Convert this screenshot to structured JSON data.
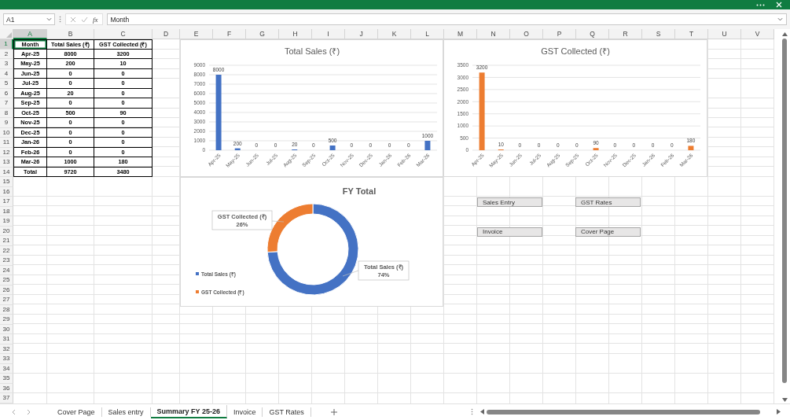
{
  "formula_bar": {
    "name_box": "A1",
    "function_label": "fx",
    "value": "Month"
  },
  "column_headers": [
    {
      "label": "A",
      "selected": true
    },
    {
      "label": "B",
      "selected": false
    },
    {
      "label": "C",
      "selected": false
    },
    {
      "label": "D",
      "selected": false
    },
    {
      "label": "E",
      "selected": false
    },
    {
      "label": "F",
      "selected": false
    },
    {
      "label": "G",
      "selected": false
    },
    {
      "label": "H",
      "selected": false
    },
    {
      "label": "I",
      "selected": false
    },
    {
      "label": "J",
      "selected": false
    },
    {
      "label": "K",
      "selected": false
    },
    {
      "label": "L",
      "selected": false
    },
    {
      "label": "M",
      "selected": false
    },
    {
      "label": "N",
      "selected": false
    },
    {
      "label": "O",
      "selected": false
    },
    {
      "label": "P",
      "selected": false
    },
    {
      "label": "Q",
      "selected": false
    },
    {
      "label": "R",
      "selected": false
    },
    {
      "label": "S",
      "selected": false
    },
    {
      "label": "T",
      "selected": false
    },
    {
      "label": "U",
      "selected": false
    },
    {
      "label": "V",
      "selected": false
    }
  ],
  "row_headers": [
    {
      "label": "1",
      "selected": true
    },
    {
      "label": "2",
      "selected": false
    },
    {
      "label": "3",
      "selected": false
    },
    {
      "label": "4",
      "selected": false
    },
    {
      "label": "5",
      "selected": false
    },
    {
      "label": "6",
      "selected": false
    },
    {
      "label": "7",
      "selected": false
    },
    {
      "label": "8",
      "selected": false
    },
    {
      "label": "9",
      "selected": false
    },
    {
      "label": "10",
      "selected": false
    },
    {
      "label": "11",
      "selected": false
    },
    {
      "label": "12",
      "selected": false
    },
    {
      "label": "13",
      "selected": false
    },
    {
      "label": "14",
      "selected": false
    },
    {
      "label": "15",
      "selected": false
    },
    {
      "label": "16",
      "selected": false
    },
    {
      "label": "17",
      "selected": false
    },
    {
      "label": "18",
      "selected": false
    },
    {
      "label": "19",
      "selected": false
    },
    {
      "label": "20",
      "selected": false
    },
    {
      "label": "21",
      "selected": false
    },
    {
      "label": "22",
      "selected": false
    },
    {
      "label": "23",
      "selected": false
    },
    {
      "label": "24",
      "selected": false
    },
    {
      "label": "25",
      "selected": false
    },
    {
      "label": "26",
      "selected": false
    },
    {
      "label": "27",
      "selected": false
    },
    {
      "label": "28",
      "selected": false
    },
    {
      "label": "29",
      "selected": false
    },
    {
      "label": "30",
      "selected": false
    },
    {
      "label": "31",
      "selected": false
    },
    {
      "label": "32",
      "selected": false
    },
    {
      "label": "33",
      "selected": false
    },
    {
      "label": "34",
      "selected": false
    },
    {
      "label": "35",
      "selected": false
    },
    {
      "label": "36",
      "selected": false
    },
    {
      "label": "37",
      "selected": false
    }
  ],
  "table": {
    "rows": [
      [
        {
          "text": "Month",
          "selected": true
        },
        {
          "text": "Total Sales (₹)",
          "selected": false
        },
        {
          "text": "GST Collected (₹)",
          "selected": false
        }
      ],
      [
        {
          "text": "Apr-25",
          "selected": false
        },
        {
          "text": "8000",
          "selected": false
        },
        {
          "text": "3200",
          "selected": false
        }
      ],
      [
        {
          "text": "May-25",
          "selected": false
        },
        {
          "text": "200",
          "selected": false
        },
        {
          "text": "10",
          "selected": false
        }
      ],
      [
        {
          "text": "Jun-25",
          "selected": false
        },
        {
          "text": "0",
          "selected": false
        },
        {
          "text": "0",
          "selected": false
        }
      ],
      [
        {
          "text": "Jul-25",
          "selected": false
        },
        {
          "text": "0",
          "selected": false
        },
        {
          "text": "0",
          "selected": false
        }
      ],
      [
        {
          "text": "Aug-25",
          "selected": false
        },
        {
          "text": "20",
          "selected": false
        },
        {
          "text": "0",
          "selected": false
        }
      ],
      [
        {
          "text": "Sep-25",
          "selected": false
        },
        {
          "text": "0",
          "selected": false
        },
        {
          "text": "0",
          "selected": false
        }
      ],
      [
        {
          "text": "Oct-25",
          "selected": false
        },
        {
          "text": "500",
          "selected": false
        },
        {
          "text": "90",
          "selected": false
        }
      ],
      [
        {
          "text": "Nov-25",
          "selected": false
        },
        {
          "text": "0",
          "selected": false
        },
        {
          "text": "0",
          "selected": false
        }
      ],
      [
        {
          "text": "Dec-25",
          "selected": false
        },
        {
          "text": "0",
          "selected": false
        },
        {
          "text": "0",
          "selected": false
        }
      ],
      [
        {
          "text": "Jan-26",
          "selected": false
        },
        {
          "text": "0",
          "selected": false
        },
        {
          "text": "0",
          "selected": false
        }
      ],
      [
        {
          "text": "Feb-26",
          "selected": false
        },
        {
          "text": "0",
          "selected": false
        },
        {
          "text": "0",
          "selected": false
        }
      ],
      [
        {
          "text": "Mar-26",
          "selected": false
        },
        {
          "text": "1000",
          "selected": false
        },
        {
          "text": "180",
          "selected": false
        }
      ],
      [
        {
          "text": "Total",
          "selected": false
        },
        {
          "text": "9720",
          "selected": false
        },
        {
          "text": "3480",
          "selected": false
        }
      ]
    ]
  },
  "charts": [
    {
      "chart_data": {
        "type": "bar",
        "title": "Total Sales (₹)",
        "categories": [
          "Apr-25",
          "May-25",
          "Jun-25",
          "Jul-25",
          "Aug-25",
          "Sep-25",
          "Oct-25",
          "Nov-25",
          "Dec-25",
          "Jan-26",
          "Feb-26",
          "Mar-26"
        ],
        "series": [
          {
            "color": "#4472c4",
            "values": [
              8000,
              200,
              0,
              0,
              20,
              0,
              500,
              0,
              0,
              0,
              0,
              1000
            ]
          }
        ],
        "grid": true,
        "ylim": [
          0,
          9000
        ],
        "yticks": [
          0,
          1000,
          2000,
          3000,
          4000,
          5000,
          6000,
          7000,
          8000,
          9000
        ],
        "data_labels": true
      }
    },
    {
      "chart_data": {
        "type": "bar",
        "title": "GST Collected (₹)",
        "categories": [
          "Apr-25",
          "May-25",
          "Jun-25",
          "Jul-25",
          "Aug-25",
          "Sep-25",
          "Oct-25",
          "Nov-25",
          "Dec-25",
          "Jan-26",
          "Feb-26",
          "Mar-26"
        ],
        "series": [
          {
            "color": "#ed7d31",
            "values": [
              3200,
              10,
              0,
              0,
              0,
              0,
              90,
              0,
              0,
              0,
              0,
              180
            ]
          }
        ],
        "grid": true,
        "ylim": [
          0,
          3500
        ],
        "yticks": [
          0,
          500,
          1000,
          1500,
          2000,
          2500,
          3000,
          3500
        ],
        "data_labels": true
      }
    }
  ],
  "donut": {
    "chart_data": {
      "type": "donut",
      "title": "FY Total",
      "categories": [
        "Total Sales (₹)",
        "GST Collected (₹)"
      ],
      "values": [
        74,
        26
      ],
      "value_labels": [
        "74%",
        "26%"
      ]
    },
    "legend": [
      {
        "label": "Total Sales (₹)",
        "color": "#4472c4"
      },
      {
        "label": "GST Collected (₹)",
        "color": "#ed7d31"
      }
    ]
  },
  "shape_buttons": [
    {
      "label": "Sales Entry"
    },
    {
      "label": "GST Rates"
    },
    {
      "label": "Invoice"
    },
    {
      "label": "Cover Page"
    }
  ],
  "sheet_tabs": [
    {
      "label": "Cover Page",
      "selected": false
    },
    {
      "label": "Sales entry",
      "selected": false
    },
    {
      "label": "Summary FY 25-26",
      "selected": true
    },
    {
      "label": "Invoice",
      "selected": false
    },
    {
      "label": "GST Rates",
      "selected": false
    }
  ]
}
